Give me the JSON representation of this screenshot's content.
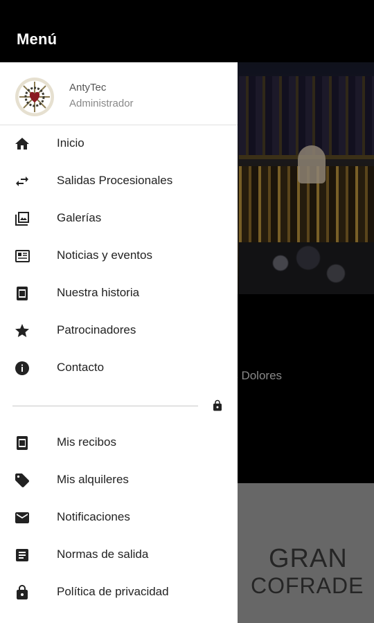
{
  "appbar": {
    "title": "Menú"
  },
  "background": {
    "event_text": "los Dolores",
    "logo": {
      "line1": "GRAN",
      "line2": "COFRADE"
    }
  },
  "drawer": {
    "user": {
      "name": "AntyTec",
      "role": "Administrador"
    },
    "items": [
      {
        "label": "Inicio",
        "icon": "home-icon"
      },
      {
        "label": "Salidas Procesionales",
        "icon": "swap-arrows-icon"
      },
      {
        "label": "Galerías",
        "icon": "photo-gallery-icon"
      },
      {
        "label": "Noticias y eventos",
        "icon": "newspaper-icon"
      },
      {
        "label": "Nuestra historia",
        "icon": "book-icon"
      },
      {
        "label": "Patrocinadores",
        "icon": "star-icon"
      },
      {
        "label": "Contacto",
        "icon": "info-icon"
      }
    ],
    "private_items": [
      {
        "label": "Mis recibos",
        "icon": "receipt-icon"
      },
      {
        "label": "Mis alquileres",
        "icon": "tag-icon"
      },
      {
        "label": "Notificaciones",
        "icon": "mail-icon"
      },
      {
        "label": "Normas de salida",
        "icon": "document-icon"
      },
      {
        "label": "Política de privacidad",
        "icon": "lock-icon"
      }
    ]
  },
  "colors": {
    "appbar": "#000000",
    "drawer": "#ffffff",
    "icon": "#222222",
    "banner": "#9e9e9e"
  }
}
